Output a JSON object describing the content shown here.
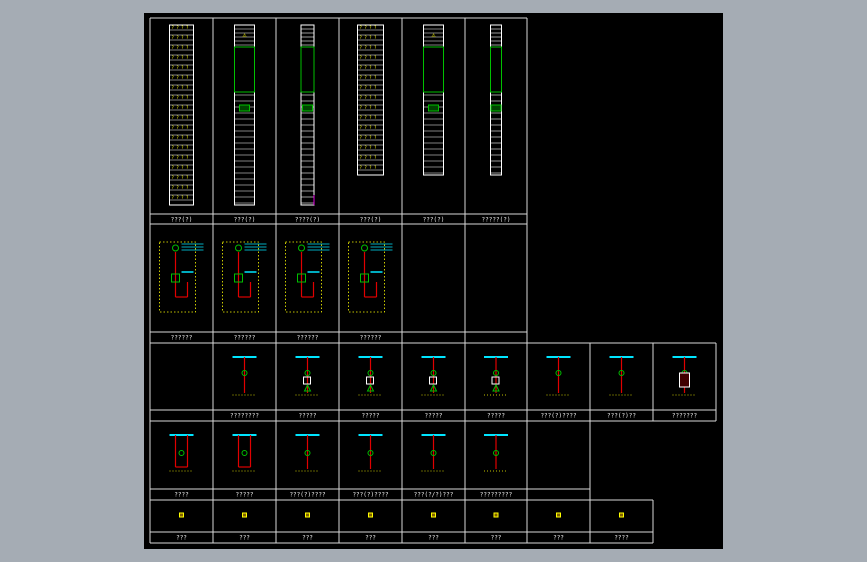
{
  "colors": {
    "background": "#a5acb4",
    "viewport": "#000000",
    "frame": "#d8d8d8",
    "caption": "#e8e8e8",
    "yellow": "#ffff00",
    "cyan": "#00e5ff",
    "green": "#00c000",
    "red": "#e00000",
    "magenta": "#e000e0",
    "white": "#ffffff"
  },
  "rows": [
    {
      "name": "cabinet-elevations",
      "captions": [
        "???(?)",
        "???(?)",
        "????(?)",
        "???(?)",
        "???(?)",
        "?????(?)"
      ]
    },
    {
      "name": "circuit-sheets-a",
      "captions": [
        "??????",
        "??????",
        "??????",
        "??????",
        "",
        ""
      ]
    },
    {
      "name": "circuit-sheets-b",
      "captions": [
        "",
        "????????",
        "?????",
        "?????",
        "?????",
        "?????",
        "???(?)????",
        "???(?)??",
        "???????"
      ]
    },
    {
      "name": "circuit-sheets-c",
      "captions": [
        "????",
        "?????",
        "???(?)????",
        "???(?)????",
        "???(?/?)???",
        "?????????",
        ""
      ]
    },
    {
      "name": "symbol-legend",
      "captions": [
        "???",
        "???",
        "???",
        "???",
        "???",
        "???",
        "???",
        "????"
      ]
    }
  ]
}
